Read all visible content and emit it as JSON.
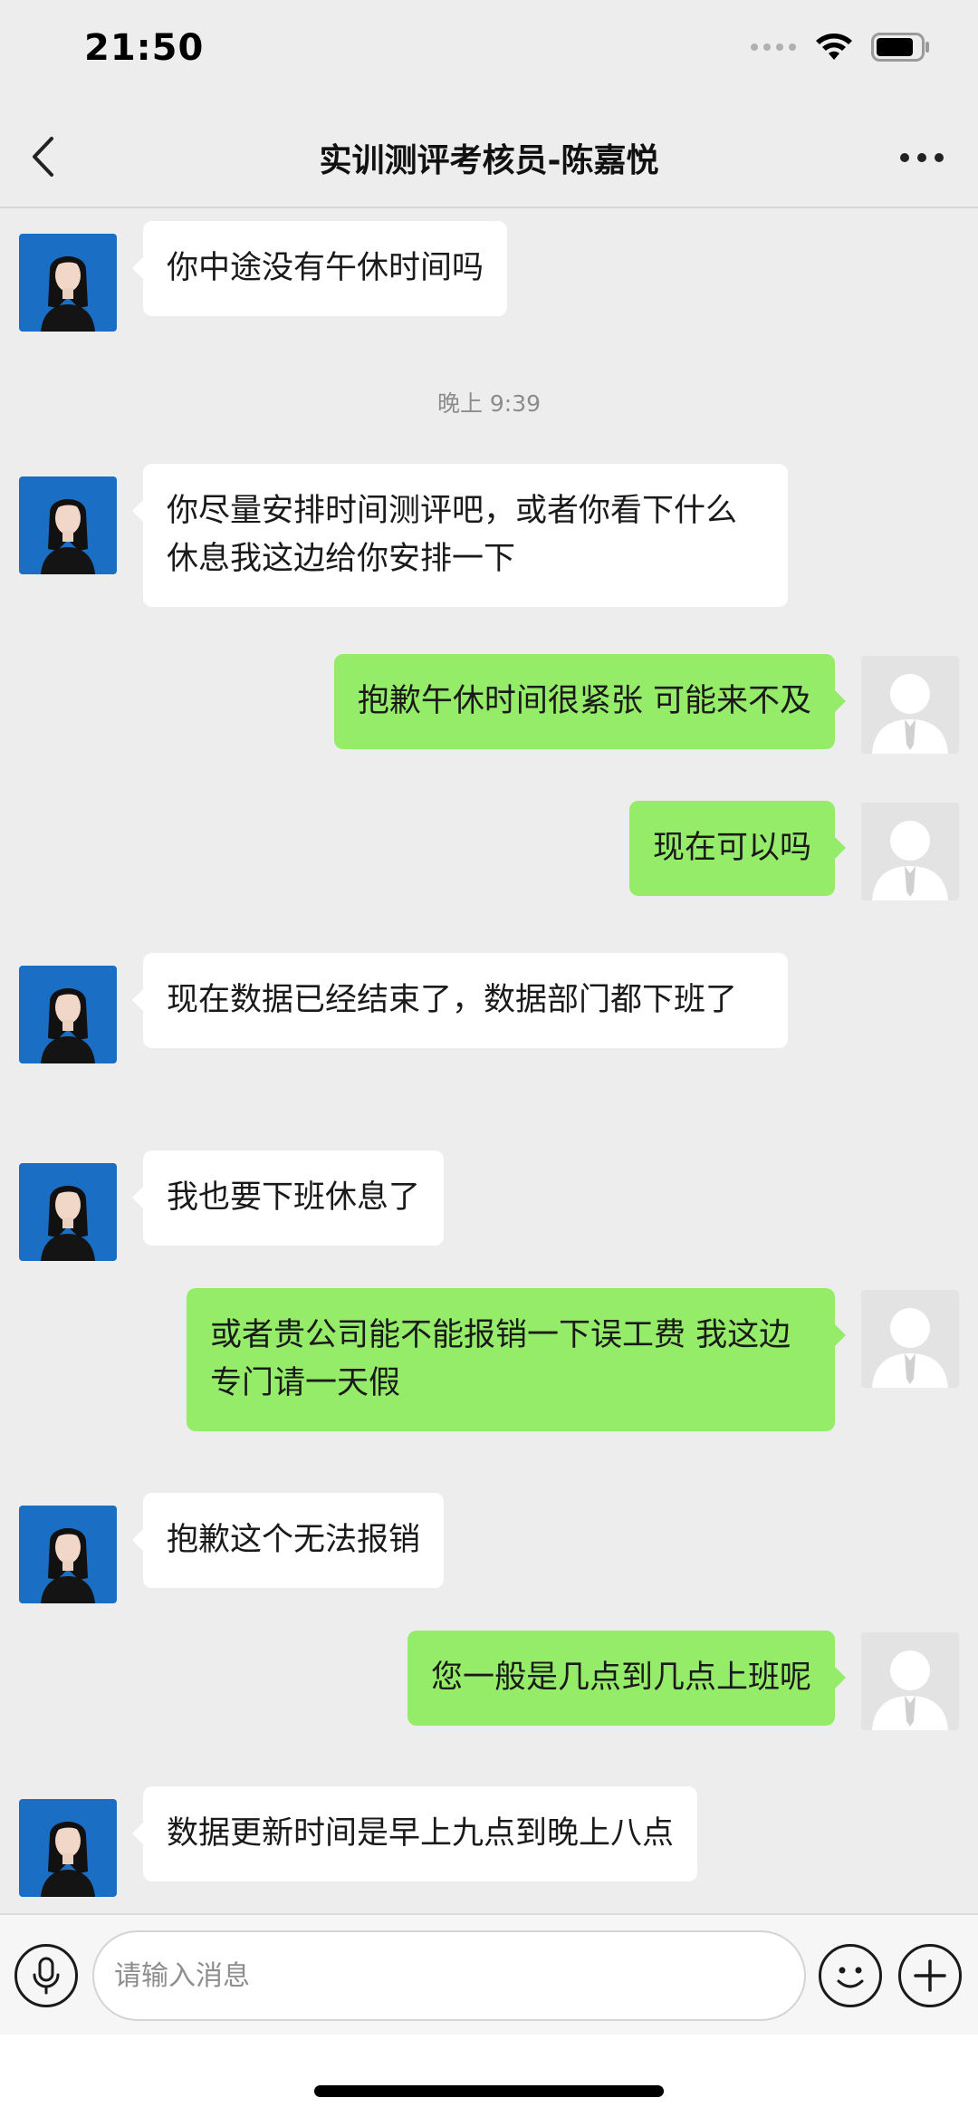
{
  "status_bar": {
    "time": "21:50"
  },
  "header": {
    "title": "实训测评考核员-陈嘉悦"
  },
  "messages": [
    {
      "side": "left",
      "text": "你中途没有午休时间吗"
    },
    {
      "type": "timestamp",
      "text": "晚上 9:39"
    },
    {
      "side": "left",
      "text": "你尽量安排时间测评吧，或者你看下什么休息我这边给你安排一下"
    },
    {
      "side": "right",
      "text": "抱歉午休时间很紧张 可能来不及"
    },
    {
      "side": "right",
      "text": "现在可以吗"
    },
    {
      "side": "left",
      "text": "现在数据已经结束了，数据部门都下班了"
    },
    {
      "side": "left",
      "text": "我也要下班休息了"
    },
    {
      "side": "right",
      "text": "或者贵公司能不能报销一下误工费 我这边专门请一天假"
    },
    {
      "side": "left",
      "text": "抱歉这个无法报销"
    },
    {
      "side": "right",
      "text": "您一般是几点到几点上班呢"
    },
    {
      "side": "left",
      "text": "数据更新时间是早上九点到晚上八点"
    }
  ],
  "input": {
    "placeholder": "请输入消息"
  },
  "colors": {
    "background": "#ededed",
    "sent_bubble": "#95ec69",
    "received_bubble": "#ffffff",
    "contact_avatar_bg": "#1a6fc4"
  },
  "icons": [
    "back-arrow-icon",
    "more-icon",
    "voice-icon",
    "emoji-icon",
    "plus-icon",
    "wifi-icon",
    "battery-icon",
    "signal-icon"
  ]
}
